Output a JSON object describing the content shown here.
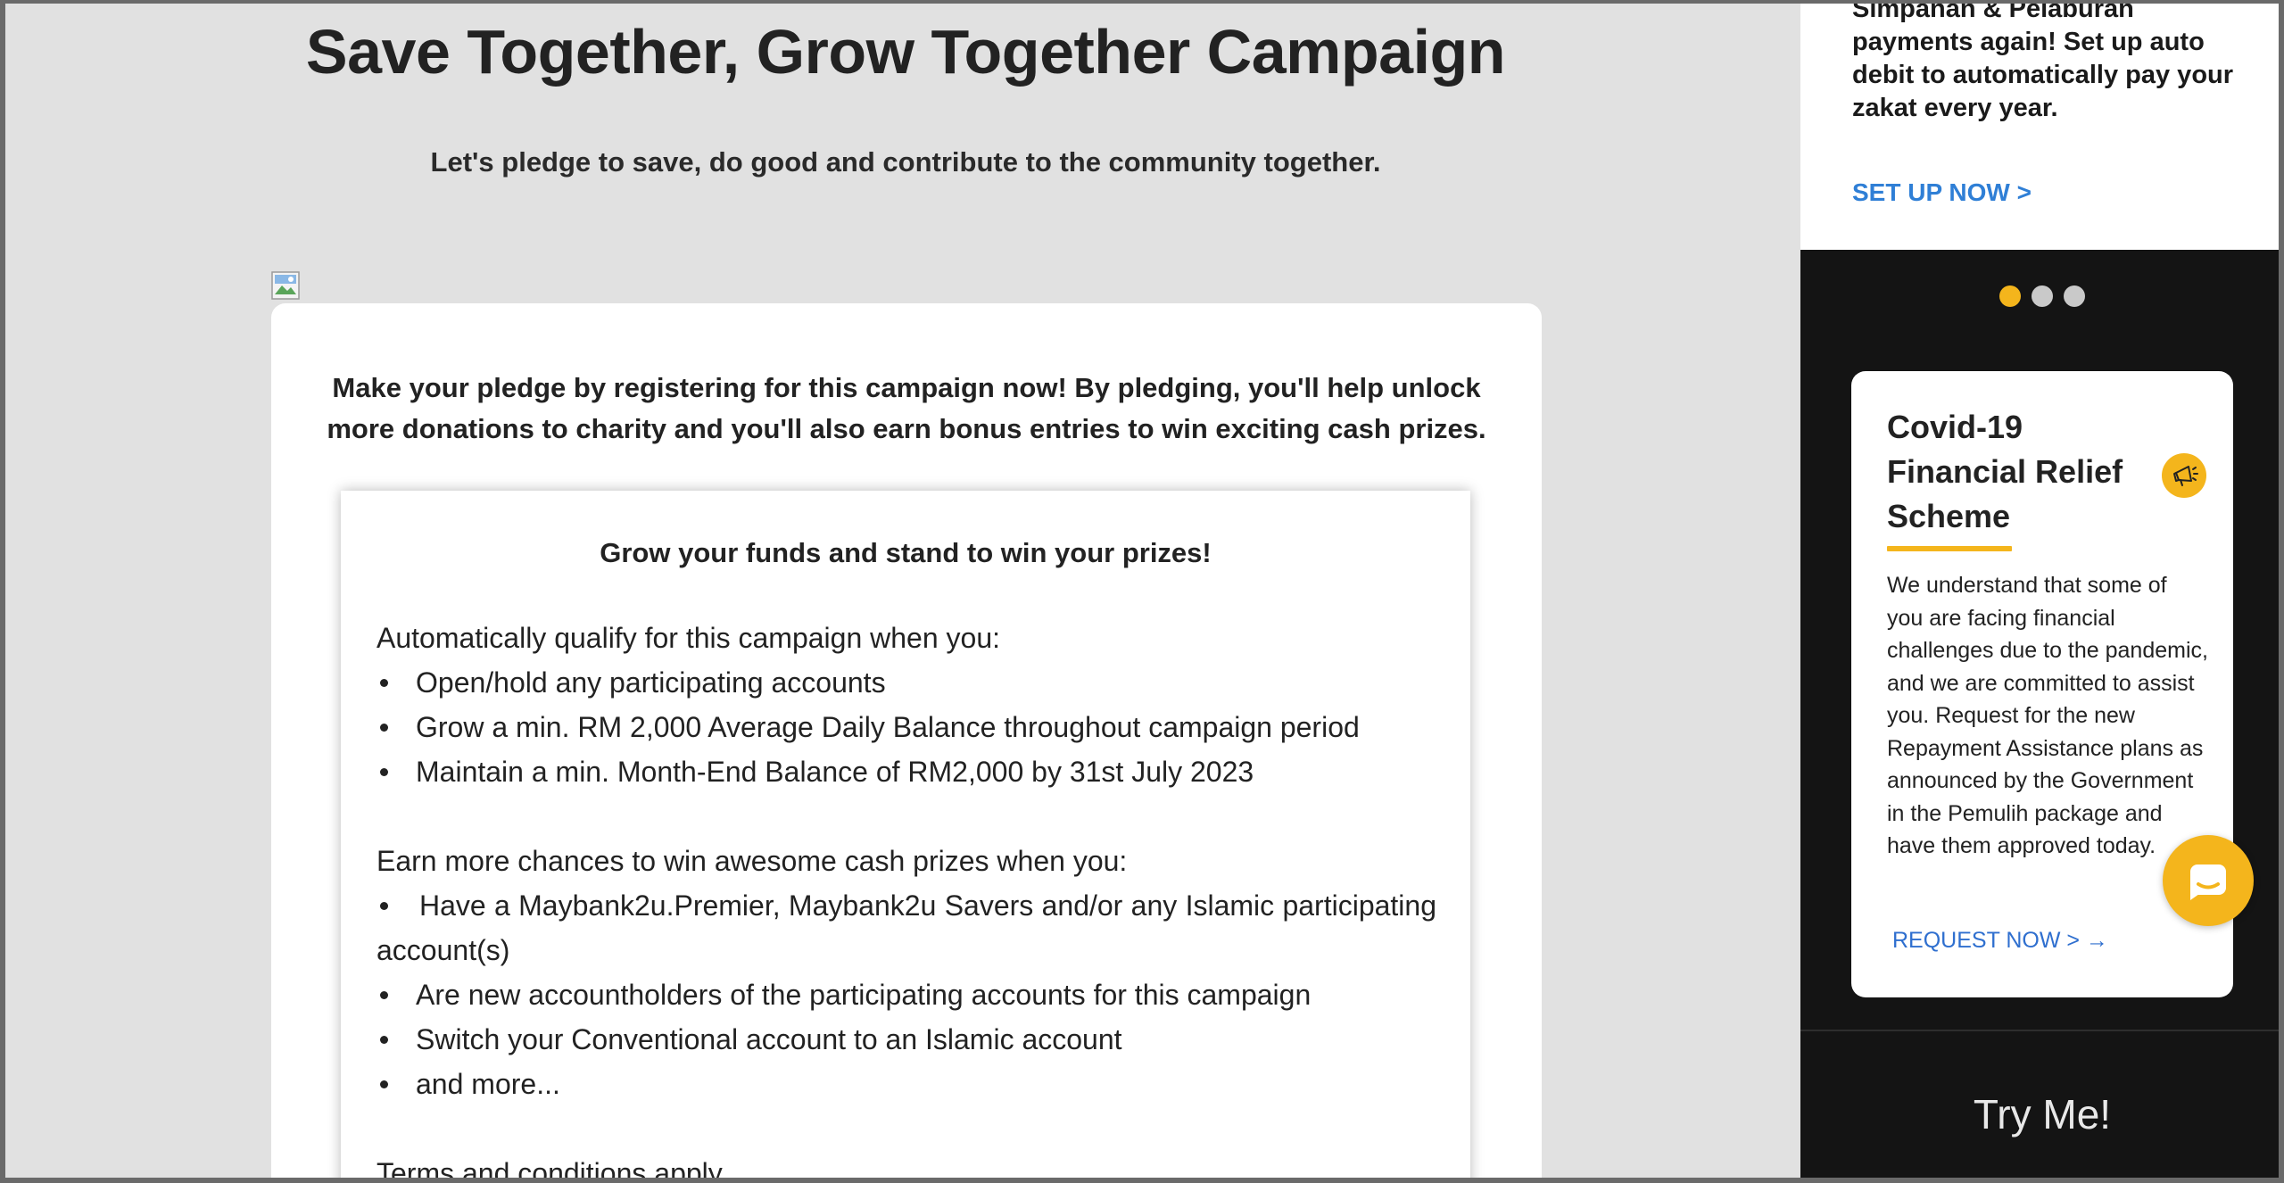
{
  "main": {
    "title": "Save Together, Grow Together Campaign",
    "subtitle": "Let's pledge to save, do good and contribute to the community together.",
    "card": {
      "intro": "Make your pledge by registering for this campaign now! By pledging, you'll help unlock more donations to charity and you'll also earn bonus entries to win exciting cash prizes.",
      "box": {
        "title": "Grow your funds and stand to win your prizes!",
        "qualify_heading": "Automatically qualify for this campaign when you:",
        "qualify_items": [
          "Open/hold any participating accounts",
          "Grow a min. RM 2,000 Average Daily Balance throughout campaign period",
          "Maintain a min. Month-End Balance of RM2,000 by 31st July 2023"
        ],
        "chances_heading": "Earn more chances to win awesome cash prizes when you:",
        "chances_items": [
          "Have a Maybank2u.Premier, Maybank2u Savers and/or any Islamic participating account(s)",
          "Are new accountholders of the participating accounts for this campaign",
          "Switch your Conventional account to an Islamic account",
          "and more..."
        ],
        "terms": "Terms and conditions apply."
      }
    }
  },
  "sidebar": {
    "promo": {
      "text": "Simpanan & Pelaburan payments again! Set up auto debit to automatically pay your zakat every year.",
      "link": "SET UP NOW >"
    },
    "carousel": {
      "active_index": 0,
      "count": 3
    },
    "relief": {
      "title": "Covid-19 Financial Relief Scheme",
      "icon": "megaphone-icon",
      "body": "We understand that some of you are facing financial challenges due to the pandemic, and we are committed to assist you. Request for the new Repayment Assistance plans as announced by the Government in the Pemulih package and have them approved today.",
      "link": "REQUEST NOW > →"
    },
    "try_me": "Try Me!"
  },
  "colors": {
    "accent_yellow": "#f4b51c",
    "link_blue": "#2f7fd6",
    "sidebar_dark": "#141414",
    "page_grey": "#e1e1e1"
  }
}
